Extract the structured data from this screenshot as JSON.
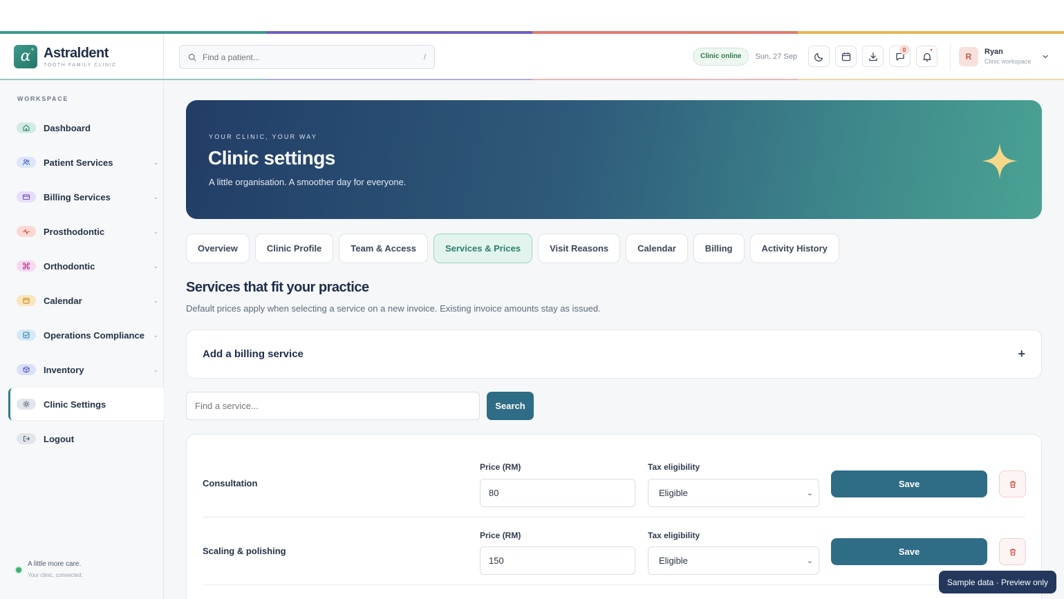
{
  "brand": {
    "name": "Astraldent",
    "tagline": "TOOTH FAMILY CLINIC",
    "logo_letter": "α"
  },
  "colors": {
    "accent_teal": "#3c9a8a",
    "accent_purple": "#6b5fc4",
    "accent_coral": "#e27a6d",
    "accent_gold": "#e6b954",
    "primary_button": "#2f6c86",
    "hero_start": "#223d66",
    "hero_end": "#4aa293"
  },
  "header": {
    "search_placeholder": "Find a patient...",
    "search_shortcut": "/",
    "status": "Clinic online",
    "date": "Sun, 27 Sep",
    "icons": [
      "moon-icon",
      "calendar-icon",
      "download-icon",
      "messages-icon",
      "bell-icon"
    ],
    "messages_count": "0",
    "notifications_badge": "•",
    "user": {
      "initial": "R",
      "name": "Ryan",
      "subtitle": "Clinic workspace"
    }
  },
  "sidebar": {
    "section_label": "WORKSPACE",
    "items": [
      {
        "label": "Dashboard",
        "icon": "home-icon",
        "has_chevron": false,
        "active": false
      },
      {
        "label": "Patient Services",
        "icon": "users-icon",
        "has_chevron": true,
        "active": false
      },
      {
        "label": "Billing Services",
        "icon": "card-icon",
        "has_chevron": true,
        "active": false
      },
      {
        "label": "Prosthodontic",
        "icon": "pulse-icon",
        "has_chevron": true,
        "active": false
      },
      {
        "label": "Orthodontic",
        "icon": "command-icon",
        "has_chevron": true,
        "active": false
      },
      {
        "label": "Calendar",
        "icon": "calendar-icon",
        "has_chevron": true,
        "active": false
      },
      {
        "label": "Operations Compliance",
        "icon": "checkbox-icon",
        "has_chevron": true,
        "active": false
      },
      {
        "label": "Inventory",
        "icon": "box-icon",
        "has_chevron": true,
        "active": false
      },
      {
        "label": "Clinic Settings",
        "icon": "gear-icon",
        "has_chevron": false,
        "active": true
      },
      {
        "label": "Logout",
        "icon": "logout-icon",
        "has_chevron": false,
        "active": false
      }
    ],
    "chevron": "⌄",
    "footer": {
      "line1": "A little more care.",
      "line2": "Your clinic, connected."
    }
  },
  "hero": {
    "kicker": "YOUR CLINIC, YOUR WAY",
    "title": "Clinic settings",
    "subtitle": "A little organisation. A smoother day for everyone.",
    "icon": "sparkle-icon"
  },
  "tabs": [
    {
      "label": "Overview",
      "active": false
    },
    {
      "label": "Clinic Profile",
      "active": false
    },
    {
      "label": "Team & Access",
      "active": false
    },
    {
      "label": "Services & Prices",
      "active": true
    },
    {
      "label": "Visit Reasons",
      "active": false
    },
    {
      "label": "Calendar",
      "active": false
    },
    {
      "label": "Billing",
      "active": false
    },
    {
      "label": "Activity History",
      "active": false
    }
  ],
  "services": {
    "title": "Services that fit your practice",
    "subtitle": "Default prices apply when selecting a service on a new invoice. Existing invoice amounts stay as issued.",
    "add_title": "Add a billing service",
    "add_icon": "+",
    "search_placeholder": "Find a service...",
    "search_button": "Search",
    "price_label": "Price (RM)",
    "tax_label": "Tax eligibility",
    "save_label": "Save",
    "rows": [
      {
        "name": "Consultation",
        "price": "80",
        "tax": "Eligible"
      },
      {
        "name": "Scaling & polishing",
        "price": "150",
        "tax": "Eligible"
      }
    ]
  },
  "toast": "Sample data · Preview only"
}
